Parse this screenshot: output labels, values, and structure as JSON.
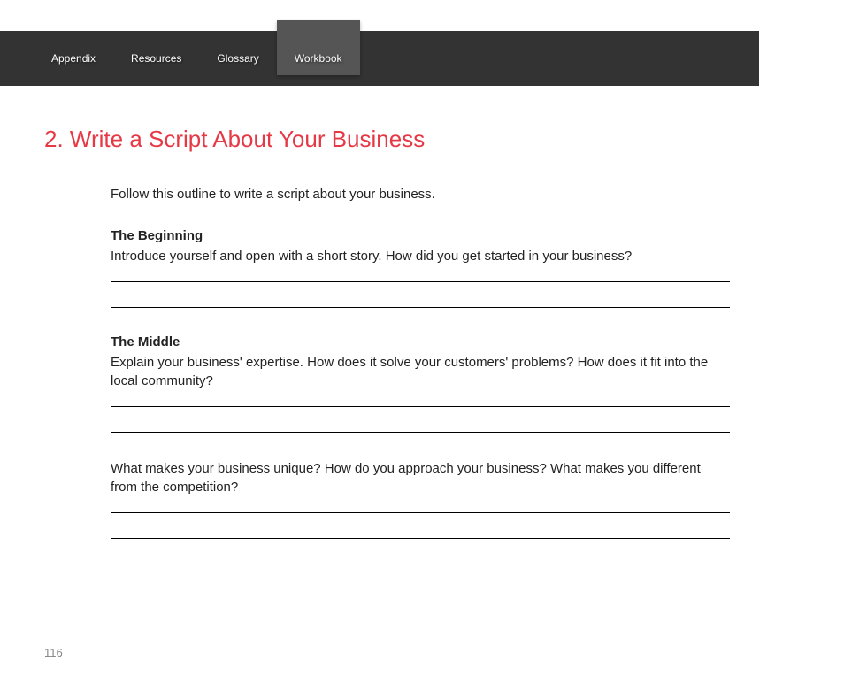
{
  "nav": {
    "tabs": [
      {
        "label": "Appendix",
        "active": false
      },
      {
        "label": "Resources",
        "active": false
      },
      {
        "label": "Glossary",
        "active": false
      },
      {
        "label": "Workbook",
        "active": true
      }
    ]
  },
  "heading": "2. Write a Script About Your Business",
  "intro": "Follow this outline to write a script about your business.",
  "sections": [
    {
      "title": "The Beginning",
      "text": "Introduce yourself and open with a short story. How did you get started in your business?"
    },
    {
      "title": "The Middle",
      "text": "Explain your business' expertise. How does it solve your customers' problems? How does it fit into the local community?"
    },
    {
      "title": "",
      "text": "What makes your business unique? How do you approach your business? What makes you different from the competition?"
    }
  ],
  "pageNumber": "116"
}
